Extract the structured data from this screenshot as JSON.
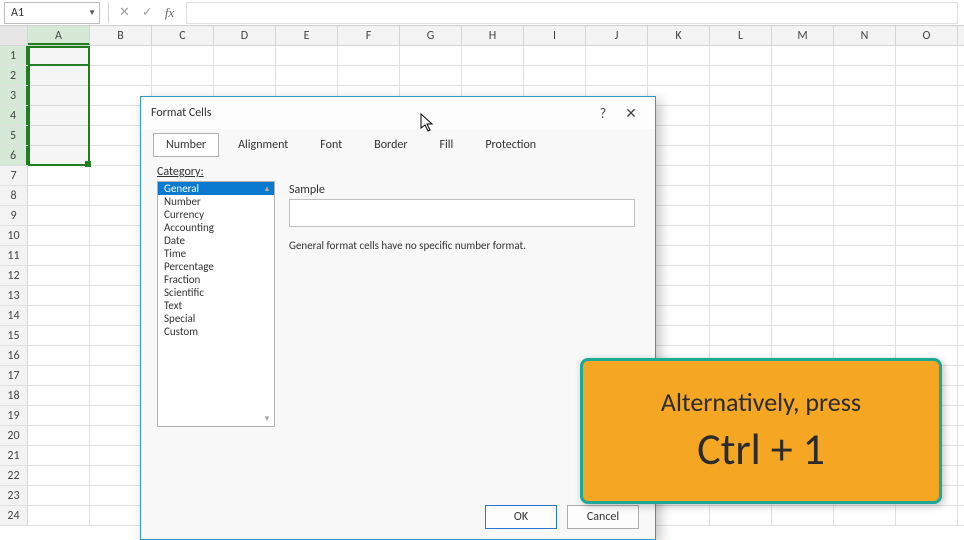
{
  "name_box": "A1",
  "formula_value": "",
  "columns": [
    "A",
    "B",
    "C",
    "D",
    "E",
    "F",
    "G",
    "H",
    "I",
    "J",
    "K",
    "L",
    "M",
    "N",
    "O"
  ],
  "rows": [
    1,
    2,
    3,
    4,
    5,
    6,
    7,
    8,
    9,
    10,
    11,
    12,
    13,
    14,
    15,
    16,
    17,
    18,
    19,
    20,
    21,
    22,
    23,
    24
  ],
  "selected_column_index": 0,
  "selected_row_start": 0,
  "selected_row_end": 5,
  "dialog": {
    "title": "Format Cells",
    "tabs": [
      "Number",
      "Alignment",
      "Font",
      "Border",
      "Fill",
      "Protection"
    ],
    "active_tab_index": 0,
    "category_label": "Category:",
    "categories": [
      "General",
      "Number",
      "Currency",
      "Accounting",
      "Date",
      "Time",
      "Percentage",
      "Fraction",
      "Scientific",
      "Text",
      "Special",
      "Custom"
    ],
    "selected_category_index": 0,
    "sample_label": "Sample",
    "info_text": "General format cells have no specific number format.",
    "ok_label": "OK",
    "cancel_label": "Cancel",
    "help_symbol": "?",
    "close_symbol": "✕"
  },
  "tooltip": {
    "line1": "Alternatively, press",
    "line2": "Ctrl + 1"
  }
}
